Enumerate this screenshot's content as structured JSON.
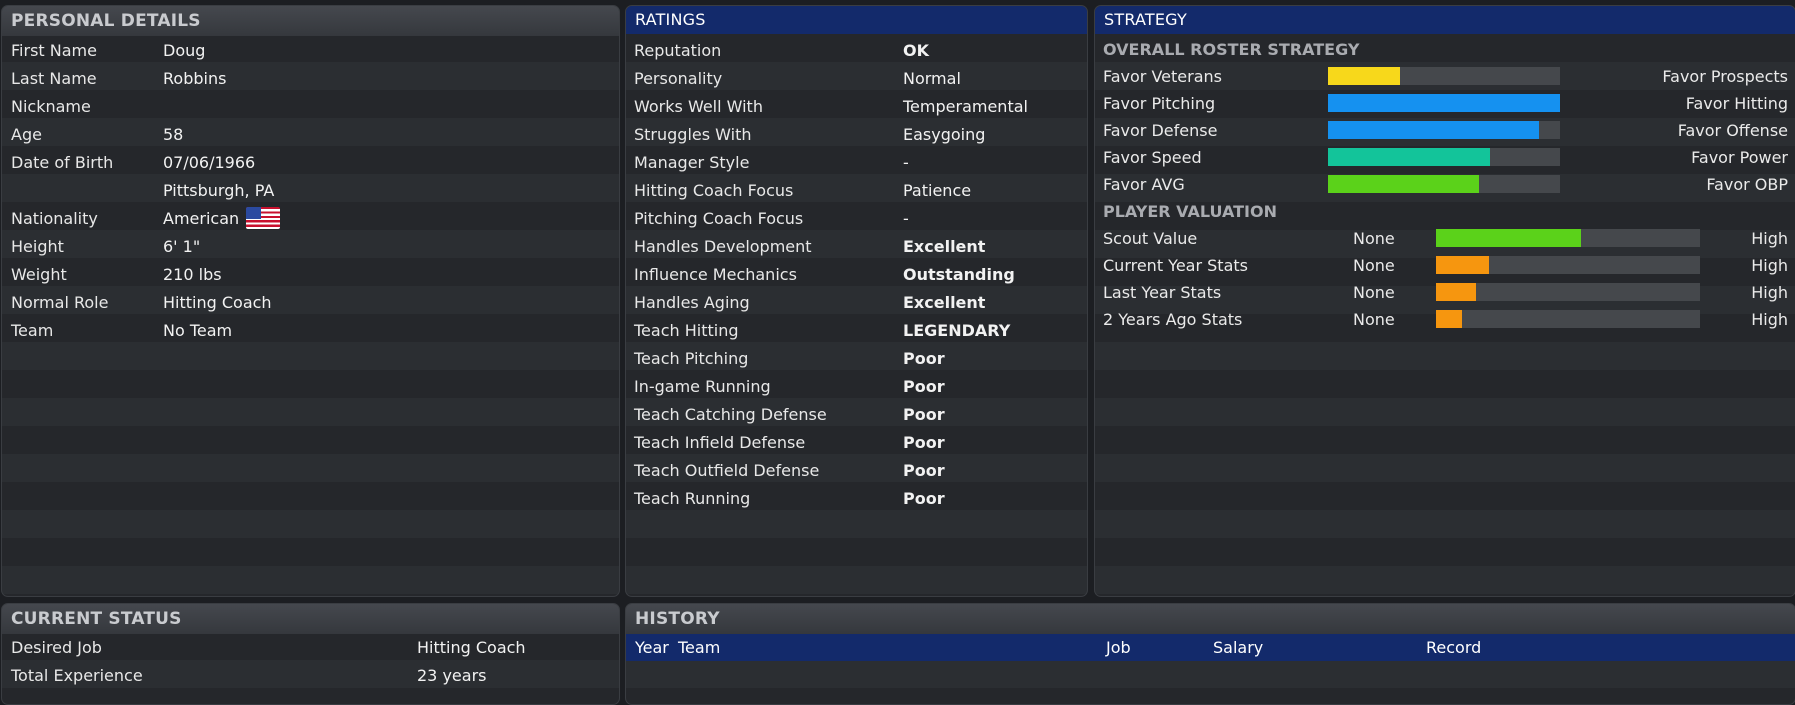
{
  "personal": {
    "title": "PERSONAL DETAILS",
    "rows": [
      {
        "label": "First Name",
        "value": "Doug"
      },
      {
        "label": "Last Name",
        "value": "Robbins"
      },
      {
        "label": "Nickname",
        "value": ""
      },
      {
        "label": "Age",
        "value": "58"
      },
      {
        "label": "Date of Birth",
        "value": "07/06/1966"
      },
      {
        "label": "",
        "value": "Pittsburgh, PA"
      },
      {
        "label": "Nationality",
        "value": "American"
      },
      {
        "label": "Height",
        "value": "6' 1\""
      },
      {
        "label": "Weight",
        "value": "210 lbs"
      },
      {
        "label": "Normal Role",
        "value": "Hitting Coach"
      },
      {
        "label": "Team",
        "value": "No Team"
      }
    ]
  },
  "ratings": {
    "title": "RATINGS",
    "rows": [
      {
        "label": "Reputation",
        "value": "OK",
        "style": "ok"
      },
      {
        "label": "Personality",
        "value": "Normal",
        "style": ""
      },
      {
        "label": "Works Well With",
        "value": "Temperamental",
        "style": ""
      },
      {
        "label": "Struggles With",
        "value": "Easygoing",
        "style": ""
      },
      {
        "label": "Manager Style",
        "value": "-",
        "style": ""
      },
      {
        "label": "Hitting Coach Focus",
        "value": "Patience",
        "style": ""
      },
      {
        "label": "Pitching Coach Focus",
        "value": "-",
        "style": ""
      },
      {
        "label": "Handles Development",
        "value": "Excellent",
        "style": "exc"
      },
      {
        "label": "Influence Mechanics",
        "value": "Outstanding",
        "style": "out"
      },
      {
        "label": "Handles Aging",
        "value": "Excellent",
        "style": "exc"
      },
      {
        "label": "Teach Hitting",
        "value": "LEGENDARY",
        "style": "out"
      },
      {
        "label": "Teach Pitching",
        "value": "Poor",
        "style": "poor"
      },
      {
        "label": "In-game Running",
        "value": "Poor",
        "style": "poor"
      },
      {
        "label": "Teach Catching Defense",
        "value": "Poor",
        "style": "poor"
      },
      {
        "label": "Teach Infield Defense",
        "value": "Poor",
        "style": "poor"
      },
      {
        "label": "Teach Outfield Defense",
        "value": "Poor",
        "style": "poor"
      },
      {
        "label": "Teach Running",
        "value": "Poor",
        "style": "poor"
      }
    ]
  },
  "strategy": {
    "title": "STRATEGY",
    "roster_title": "OVERALL ROSTER STRATEGY",
    "roster": [
      {
        "left": "Favor Veterans",
        "right": "Favor Prospects",
        "level": 0.31,
        "color": "#f7d81b"
      },
      {
        "left": "Favor Pitching",
        "right": "Favor Hitting",
        "level": 1.0,
        "color": "#1591f0"
      },
      {
        "left": "Favor Defense",
        "right": "Favor Offense",
        "level": 0.91,
        "color": "#1591f0"
      },
      {
        "left": "Favor Speed",
        "right": "Favor Power",
        "level": 0.7,
        "color": "#13c49a"
      },
      {
        "left": "Favor AVG",
        "right": "Favor OBP",
        "level": 0.65,
        "color": "#5bd21a"
      }
    ],
    "valuation_title": "PLAYER VALUATION",
    "valuation": [
      {
        "label": "Scout Value",
        "low": "None",
        "high": "High",
        "level": 0.55,
        "color": "#5bd21a"
      },
      {
        "label": "Current Year Stats",
        "low": "None",
        "high": "High",
        "level": 0.2,
        "color": "#f6960f"
      },
      {
        "label": "Last Year Stats",
        "low": "None",
        "high": "High",
        "level": 0.15,
        "color": "#f6960f"
      },
      {
        "label": "2 Years Ago Stats",
        "low": "None",
        "high": "High",
        "level": 0.1,
        "color": "#f6960f"
      }
    ]
  },
  "status": {
    "title": "CURRENT STATUS",
    "rows": [
      {
        "label": "Desired Job",
        "value": "Hitting Coach"
      },
      {
        "label": "Total Experience",
        "value": "23 years"
      }
    ]
  },
  "history": {
    "title": "HISTORY",
    "columns": {
      "year": "Year",
      "team": "Team",
      "job": "Job",
      "salary": "Salary",
      "record": "Record"
    }
  }
}
